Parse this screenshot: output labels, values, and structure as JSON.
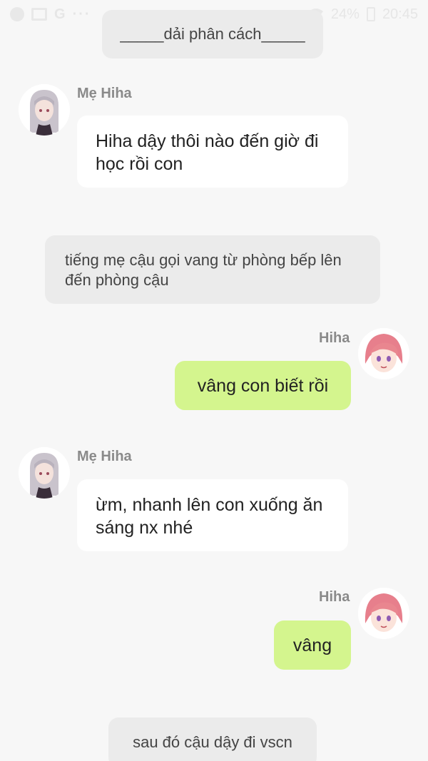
{
  "status_bar": {
    "signal_text": "24%",
    "time": "20:45",
    "icons": [
      "messenger-icon",
      "gallery-icon",
      "google-icon",
      "more-icon",
      "wifi-icon",
      "battery-icon"
    ]
  },
  "chat": {
    "divider_text": "_____dải phân cách_____",
    "messages": [
      {
        "side": "left",
        "sender": "Mẹ Hiha",
        "text": "Hiha dậy thôi nào đến giờ đi học rồi con"
      },
      {
        "side": "narration",
        "text": "tiếng mẹ cậu gọi vang từ phòng bếp lên đến phòng cậu"
      },
      {
        "side": "right",
        "sender": "Hiha",
        "text": "vâng con biết rồi"
      },
      {
        "side": "left",
        "sender": "Mẹ Hiha",
        "text": "ừm, nhanh lên con xuống ăn sáng nx nhé"
      },
      {
        "side": "right",
        "sender": "Hiha",
        "text": "vâng"
      },
      {
        "side": "narration",
        "text": "sau đó cậu dậy đi vscn"
      }
    ]
  },
  "colors": {
    "background": "#f7f7f7",
    "left_bubble": "#ffffff",
    "right_bubble": "#d4f58e",
    "narration_bg": "#ebebeb",
    "sender_name": "#8a8a8a"
  }
}
